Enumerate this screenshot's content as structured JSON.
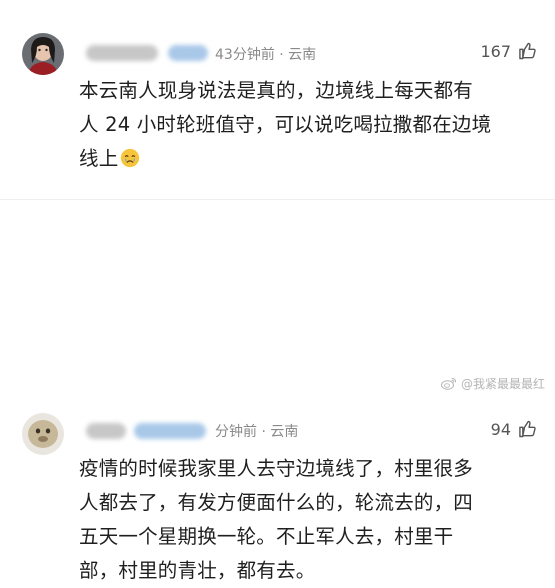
{
  "comments": [
    {
      "time_location": "43分钟前 · 云南",
      "likes": "167",
      "text_lines": [
        "本云南人现身说法是真的，边境线上每天都有",
        "人 24 小时轮班值守，可以说吃喝拉撒都在边境",
        "线上"
      ],
      "emoji": "crying-face"
    },
    {
      "time_location": "分钟前 · 云南",
      "likes": "94",
      "text_lines": [
        "疫情的时候我家里人去守边境线了，村里很多",
        "人都去了，有发方便面什么的，轮流去的，四",
        "五天一个星期换一轮。不止军人去，村里干",
        "部，村里的青壮，都有去。"
      ]
    }
  ],
  "watermark": {
    "text": "@我紧最最最红"
  },
  "icons": {
    "like": "thumbs-up-icon",
    "watermark_logo": "weibo-logo-icon"
  },
  "colors": {
    "text": "#1f1f1f",
    "meta": "#8a8a8a",
    "blur_name": "#c7c7c7",
    "blur_badge": "#a9c8e8",
    "emoji_yellow": "#f7c53b",
    "tear_blue": "#5aa7e6"
  }
}
